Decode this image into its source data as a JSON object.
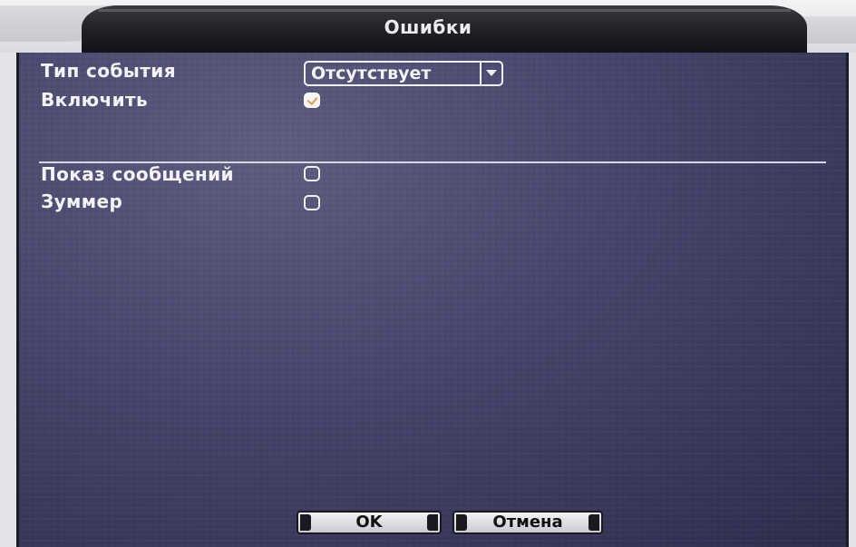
{
  "dialog": {
    "title": "Ошибки"
  },
  "form": {
    "event_type_label": "Тип события",
    "event_type_value": "Отсутствует",
    "enable_label": "Включить",
    "enable_checked": true,
    "show_message_label": "Показ сообщений",
    "show_message_checked": false,
    "buzzer_label": "Зуммер",
    "buzzer_checked": false
  },
  "buttons": {
    "ok_label": "OK",
    "cancel_label": "Отмена"
  },
  "colors": {
    "panel": "#45446a",
    "checkmark": "#e39a48",
    "title_bar": "#202024"
  },
  "icons": {
    "dropdown": "chevron-down-icon",
    "check": "checkmark-icon"
  }
}
